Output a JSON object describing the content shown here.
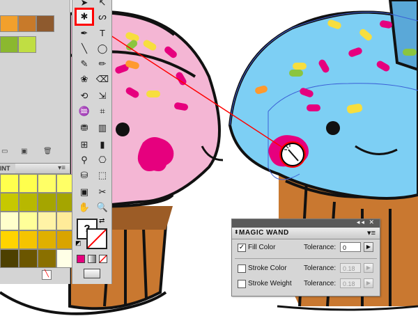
{
  "panel": {
    "title": "MAGIC WAND",
    "options": [
      {
        "label": "Fill Color",
        "checked": true,
        "tolerance_label": "Tolerance:",
        "tolerance": "0",
        "enabled": true
      },
      {
        "label": "Stroke Color",
        "checked": false,
        "tolerance_label": "Tolerance:",
        "tolerance": "0.18",
        "enabled": false
      },
      {
        "label": "Stroke Weight",
        "checked": false,
        "tolerance_label": "Tolerance:",
        "tolerance": "0.18",
        "enabled": false
      }
    ]
  },
  "swatches_panel": {
    "tab_label": "INT",
    "top_swatch_colors": [
      "#f2a02c",
      "#c87a2a",
      "#8e5a2e",
      "#8bb82f",
      "#c0de43"
    ],
    "grid_colors": [
      [
        "#ffff4d",
        "#ffff4d",
        "#ffff66",
        "#ffff66"
      ],
      [
        "#c7c800",
        "#b8b800",
        "#a5a500",
        "#a5a500"
      ],
      [
        "#ffffcc",
        "#ffff99",
        "#fff3a6",
        "#ffeb99"
      ],
      [
        "#ffd400",
        "#f5c400",
        "#e0b000",
        "#d9a400"
      ],
      [
        "#4d4000",
        "#6b5600",
        "#8a7000",
        "#ffffe6"
      ]
    ]
  },
  "toolbox": {
    "selected_tool": "magic-wand-icon",
    "fill_color": "#ffffff",
    "stroke_color": "#000000"
  },
  "colors": {
    "highlight": "#ff0000",
    "frosting_pink": "#f4b6d4",
    "frosting_blue": "#7dcff4",
    "cake_brown": "#c97830",
    "magenta": "#e6007e"
  }
}
